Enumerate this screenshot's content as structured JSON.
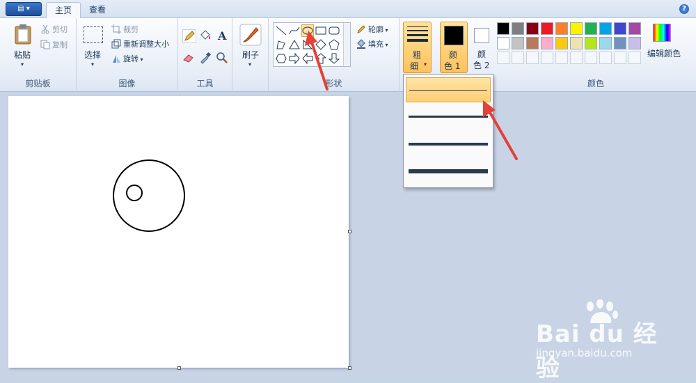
{
  "app_menu": {
    "label": "▤ ▾"
  },
  "tabs": [
    {
      "label": "主页"
    },
    {
      "label": "查看"
    }
  ],
  "help": {
    "label": "?"
  },
  "clipboard": {
    "paste": "粘贴",
    "cut": "剪切",
    "copy": "复制",
    "group_label": "剪贴板"
  },
  "image": {
    "select": "选择",
    "crop": "裁剪",
    "resize": "重新调整大小",
    "rotate": "旋转",
    "group_label": "图像"
  },
  "tools": {
    "group_label": "工具"
  },
  "brushes": {
    "label": "刷子"
  },
  "shapes": {
    "outline": "轮廓",
    "fill": "填充",
    "group_label": "形状"
  },
  "size": {
    "label_top": "粗",
    "label_bottom": "细"
  },
  "color1": {
    "label_top": "颜",
    "label_bottom": "色 1"
  },
  "color2": {
    "label_top": "颜",
    "label_bottom": "色 2"
  },
  "colors": {
    "group_label": "颜色",
    "edit": "编辑颜色",
    "row1": [
      "#000000",
      "#7f7f7f",
      "#880015",
      "#ed1c24",
      "#ff7f27",
      "#fff200",
      "#22b14c",
      "#00a2e8",
      "#3f48cc",
      "#a349a4"
    ],
    "row2": [
      "#ffffff",
      "#c3c3c3",
      "#b97a57",
      "#ffaec9",
      "#ffc90e",
      "#efe4b0",
      "#b5e61d",
      "#99d9ea",
      "#7092be",
      "#c8bfe7"
    ]
  },
  "watermark": {
    "logo": "Bai du 经验",
    "url": "jingyan.baidu.com"
  }
}
